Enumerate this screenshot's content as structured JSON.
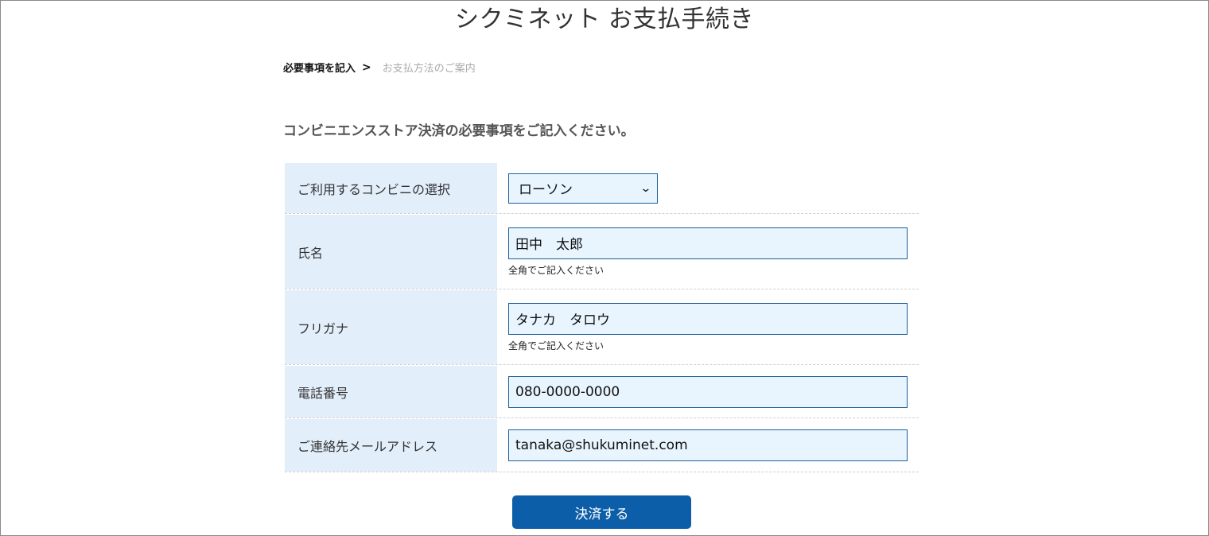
{
  "page": {
    "title": "シクミネット お支払手続き"
  },
  "breadcrumb": {
    "step1": "必要事項を記入",
    "separator": ">",
    "step2": "お支払方法のご案内"
  },
  "form": {
    "heading": "コンビニエンスストア決済の必要事項をご記入ください。",
    "convenience": {
      "label": "ご利用するコンビニの選択",
      "selected": "ローソン"
    },
    "name": {
      "label": "氏名",
      "value": "田中　太郎",
      "hint": "全角でご記入ください"
    },
    "kana": {
      "label": "フリガナ",
      "value": "タナカ　タロウ",
      "hint": "全角でご記入ください"
    },
    "phone": {
      "label": "電話番号",
      "value": "080-0000-0000"
    },
    "email": {
      "label": "ご連絡先メールアドレス",
      "value": "tanaka@shukuminet.com"
    },
    "submit_label": "決済する"
  },
  "colors": {
    "label_bg": "#e3eefb",
    "input_bg": "#e8f5ff",
    "input_border": "#1d5f9a",
    "button_bg": "#0d5ea8"
  },
  "icons": {
    "select_arrow": "chevron-down-icon"
  }
}
